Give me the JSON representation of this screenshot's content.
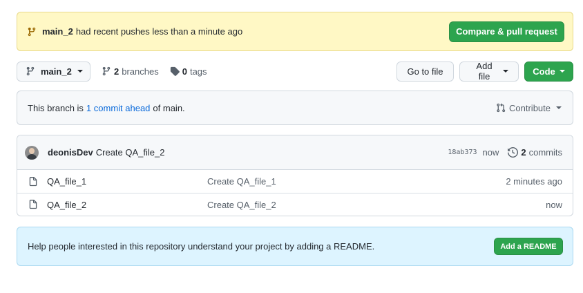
{
  "banner": {
    "branch": "main_2",
    "message": "had recent pushes less than a minute ago",
    "compare_button": "Compare & pull request"
  },
  "toolbar": {
    "branch_select": "main_2",
    "branches_count": "2",
    "branches_label": "branches",
    "tags_count": "0",
    "tags_label": "tags",
    "goto_file": "Go to file",
    "add_file": "Add file",
    "code": "Code"
  },
  "branch_info": {
    "prefix": "This branch is",
    "ahead_link": "1 commit ahead",
    "suffix": "of main.",
    "contribute": "Contribute"
  },
  "latest_commit": {
    "author": "deonisDev",
    "message": "Create QA_file_2",
    "sha": "18ab373",
    "age": "now",
    "commits_count": "2",
    "commits_label": "commits"
  },
  "files": [
    {
      "name": "QA_file_1",
      "message": "Create QA_file_1",
      "age": "2 minutes ago"
    },
    {
      "name": "QA_file_2",
      "message": "Create QA_file_2",
      "age": "now"
    }
  ],
  "readme": {
    "message": "Help people interested in this repository understand your project by adding a README.",
    "button": "Add a README"
  },
  "colors": {
    "primary_green": "#2da44e",
    "link_blue": "#0969da",
    "banner_yellow": "#fff8c5",
    "readme_blue": "#ddf4ff"
  },
  "icons": [
    "git-branch-icon",
    "tag-icon",
    "git-pull-request-icon",
    "history-icon",
    "file-icon",
    "caret-down-icon"
  ]
}
